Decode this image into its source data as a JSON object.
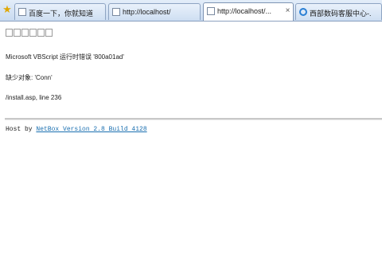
{
  "tabs": [
    {
      "label": "百度一下，你就知道",
      "icon": "page-icon",
      "active": false
    },
    {
      "label": "http://localhost/",
      "icon": "page-icon",
      "active": false
    },
    {
      "label": "http://localhost/...",
      "icon": "page-icon",
      "active": true
    },
    {
      "label": "西部数码客服中心-...",
      "icon": "ie-icon",
      "active": false
    }
  ],
  "tab_close_symbol": "×",
  "page": {
    "error_line1": "Microsoft VBScript 运行时错误 '800a01ad'",
    "error_line2": "缺少对象: 'Conn'",
    "error_line3": "/install.asp, line 236",
    "host_prefix": "Host by ",
    "host_link": "NetBox Version 2.8 Build 4128"
  }
}
